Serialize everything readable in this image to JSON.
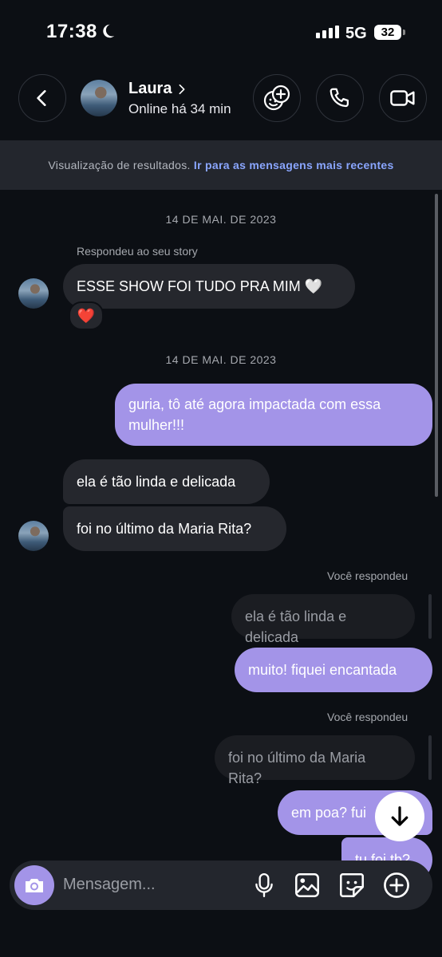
{
  "status_bar": {
    "time": "17:38",
    "network": "5G",
    "battery": "32"
  },
  "header": {
    "contact_name": "Laura",
    "presence": "Online há 34 min"
  },
  "banner": {
    "text": "Visualização de resultados.",
    "link": "Ir para as mensagens mais recentes"
  },
  "messages": {
    "date_1": "14 DE MAI. DE 2023",
    "story_meta": "Respondeu ao seu story",
    "story_reply": "ESSE SHOW FOI TUDO PRA MIM 🤍",
    "reaction": "❤️",
    "date_2": "14 DE MAI. DE 2023",
    "out_1": "guria, tô até agora impactada com essa mulher!!!",
    "in_1": "ela é tão linda e delicada",
    "in_2": "foi no último da Maria Rita?",
    "reply_meta_1": "Você respondeu",
    "quoted_1": "ela é tão linda e delicada",
    "out_2": "muito! fiquei encantada",
    "reply_meta_2": "Você respondeu",
    "quoted_2": "foi no último da Maria Rita?",
    "out_3": "em poa? fui",
    "out_4": "tu foi tb?"
  },
  "composer": {
    "placeholder": "Mensagem..."
  },
  "icons": {
    "back": "chevron-left-icon",
    "effects": "face-plus-icon",
    "call": "phone-icon",
    "video": "video-camera-icon",
    "camera": "camera-icon",
    "mic": "microphone-icon",
    "gallery": "image-icon",
    "sticker": "sticker-icon",
    "more": "plus-circle-icon",
    "scroll_down": "arrow-down-icon"
  },
  "colors": {
    "accent": "#a394e8",
    "link": "#8aa6ff",
    "background": "#0c0f14",
    "incoming": "#25272d"
  }
}
